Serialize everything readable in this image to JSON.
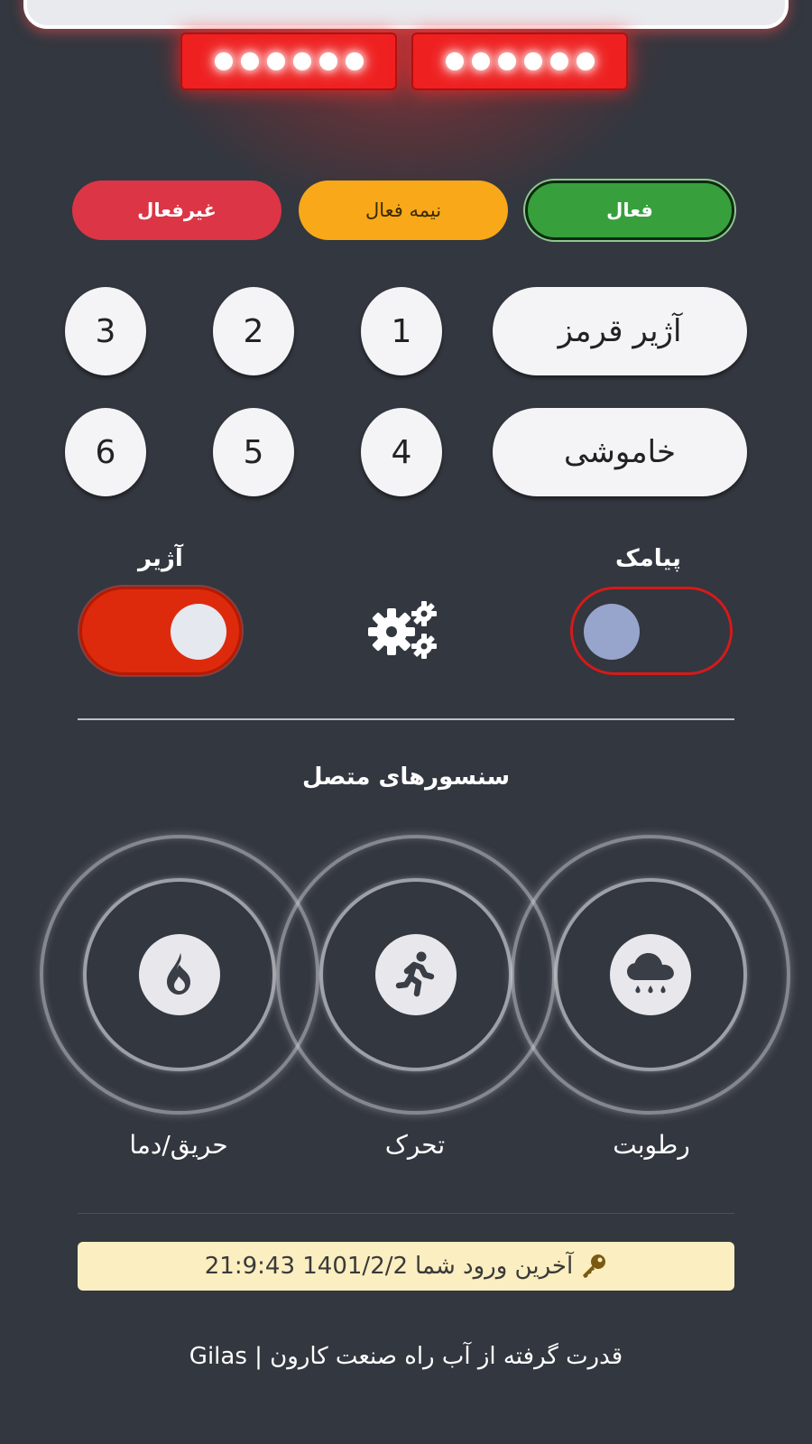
{
  "modes": {
    "active_label": "فعال",
    "semi_label": "نیمه فعال",
    "off_label": "غیرفعال"
  },
  "controls": {
    "red_siren_label": "آژیر قرمز",
    "silent_label": "خاموشی",
    "numbers": [
      "1",
      "2",
      "3",
      "4",
      "5",
      "6"
    ]
  },
  "toggles": {
    "sms_label": "پیامک",
    "sms_on": false,
    "siren_label": "آژیر",
    "siren_on": true
  },
  "sensors": {
    "title": "سنسورهای متصل",
    "items": [
      {
        "label": "رطوبت",
        "icon": "cloud-rain-icon"
      },
      {
        "label": "تحرک",
        "icon": "running-person-icon"
      },
      {
        "label": "حریق/دما",
        "icon": "flame-icon"
      }
    ]
  },
  "last_login": {
    "text": "آخرین ورود شما",
    "value": "1401/2/2 21:9:43",
    "icon": "key-icon"
  },
  "footer": {
    "text": "قدرت گرفته از آب راه صنعت کارون | Gilas"
  },
  "colors": {
    "background": "#33373f",
    "active": "#37a03d",
    "semi": "#f8a818",
    "off": "#dc3545",
    "siren_toggle": "#de2a0c",
    "alarm_light": "#ef2020"
  }
}
